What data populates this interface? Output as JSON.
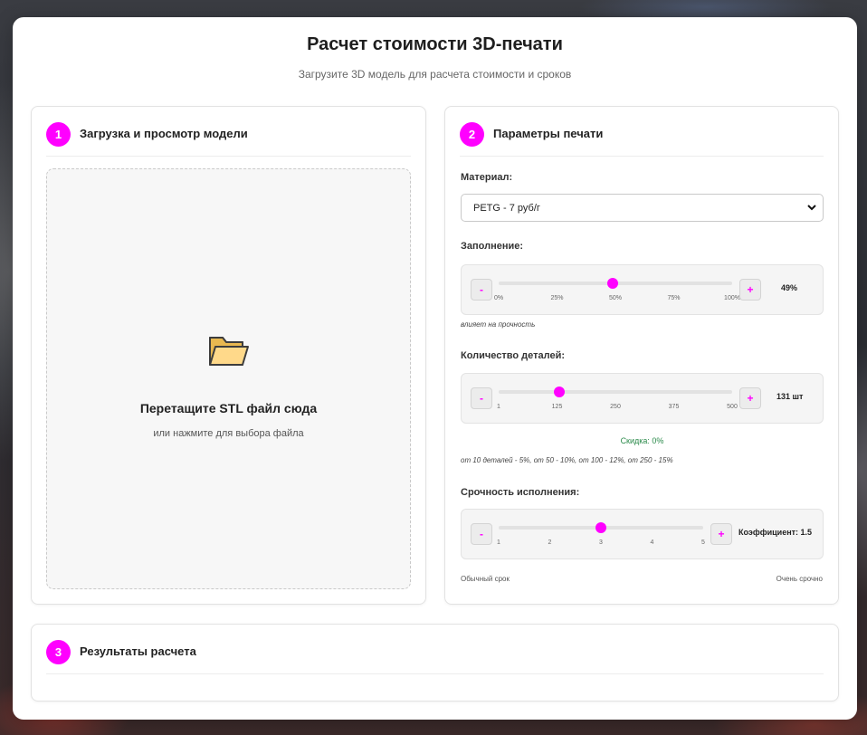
{
  "header": {
    "title": "Расчет стоимости 3D-печати",
    "subtitle": "Загрузите 3D модель для расчета стоимости и сроков"
  },
  "upload": {
    "step": "1",
    "title": "Загрузка и просмотр модели",
    "icon": "folder-icon",
    "drop_title": "Перетащите STL файл сюда",
    "drop_subtitle": "или нажмите для выбора файла"
  },
  "params": {
    "step": "2",
    "title": "Параметры печати",
    "material": {
      "label": "Материал:",
      "selected": "PETG - 7 руб/г"
    },
    "infill": {
      "label": "Заполнение:",
      "minus": "-",
      "plus": "+",
      "value": 49,
      "min": 0,
      "max": 100,
      "display": "49%",
      "ticks": [
        "0%",
        "25%",
        "50%",
        "75%",
        "100%"
      ],
      "hint": "влияет на прочность"
    },
    "quantity": {
      "label": "Количество деталей:",
      "minus": "-",
      "plus": "+",
      "value": 131,
      "min": 1,
      "max": 500,
      "display": "131 шт",
      "ticks": [
        "1",
        "125",
        "250",
        "375",
        "500"
      ],
      "discount": "Скидка: 0%",
      "hint": "от 10 деталей - 5%, от 50 - 10%, от 100 - 12%, от 250 - 15%"
    },
    "urgency": {
      "label": "Срочность исполнения:",
      "minus": "-",
      "plus": "+",
      "value": 3,
      "min": 1,
      "max": 5,
      "display": "Коэффициент: 1.5",
      "ticks": [
        "1",
        "2",
        "3",
        "4",
        "5"
      ],
      "low_label": "Обычный срок",
      "high_label": "Очень срочно"
    }
  },
  "results": {
    "step": "3",
    "title": "Результаты расчета"
  },
  "colors": {
    "accent": "#ff00ff",
    "discount": "#2a8a4a"
  }
}
